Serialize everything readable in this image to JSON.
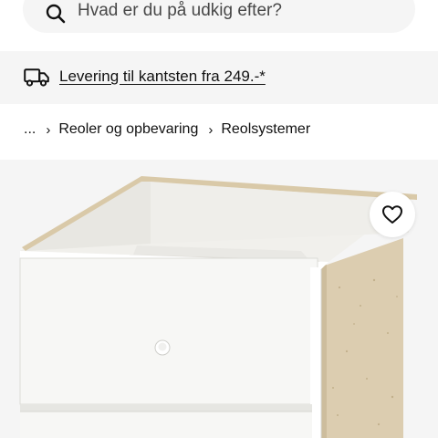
{
  "search": {
    "placeholder": "Hvad er du på udkig efter?",
    "icon": "search-icon"
  },
  "delivery": {
    "icon": "truck-icon",
    "text": "Levering til kantsten fra 249.-*"
  },
  "breadcrumb": {
    "ellipsis": "...",
    "items": [
      "Reoler og opbevaring",
      "Reolsystemer"
    ],
    "separator_icon": "chevron-right-icon"
  },
  "product": {
    "favourite_icon": "heart-icon",
    "image": "white-drawer-insert-product-image"
  }
}
